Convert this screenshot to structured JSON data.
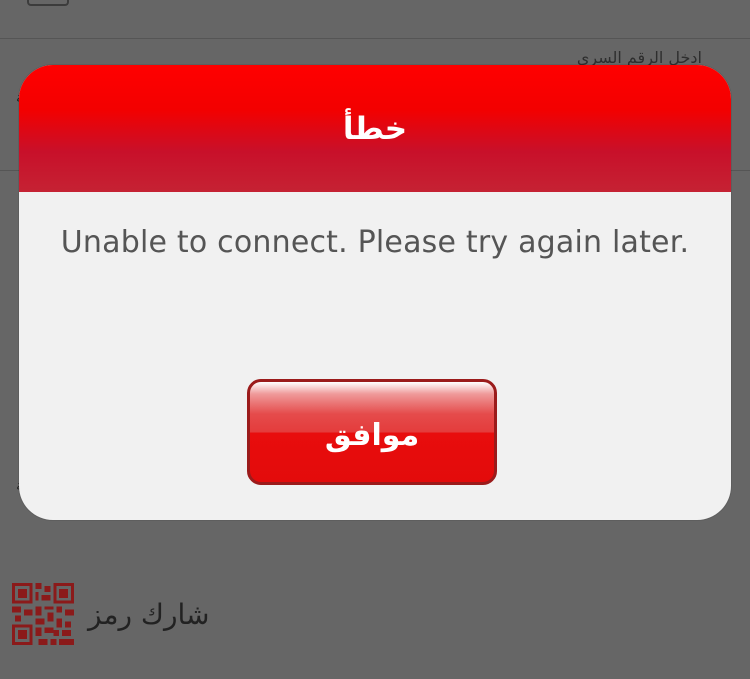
{
  "background": {
    "password_label": "ادخل الرقم السري",
    "share_code_label": "شارك رمز"
  },
  "dialog": {
    "title": "خطأ",
    "message": "Unable to connect. Please try again later.",
    "ok_button_label": "موافق"
  },
  "colors": {
    "overlay": "#666666",
    "header_red": "#ff0000",
    "header_dark_red": "#c52233",
    "dialog_body": "#f1f1f1",
    "message_text": "#555555",
    "qr_icon": "#8b1a1a"
  },
  "icons": {
    "share": "qr-code-icon"
  }
}
